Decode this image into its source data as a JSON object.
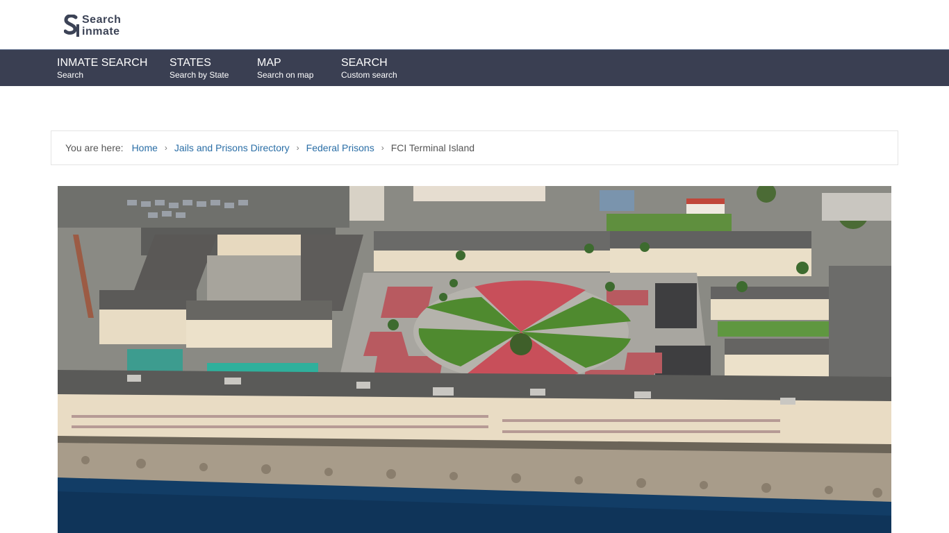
{
  "logo": {
    "line1": "Search",
    "line2": "inmate",
    "icon": "si-logo-icon"
  },
  "nav": [
    {
      "title": "INMATE SEARCH",
      "sub": "Search"
    },
    {
      "title": "STATES",
      "sub": "Search by State"
    },
    {
      "title": "MAP",
      "sub": "Search on map"
    },
    {
      "title": "SEARCH",
      "sub": "Custom search"
    }
  ],
  "breadcrumb": {
    "label": "You are here:",
    "items": [
      "Home",
      "Jails and Prisons Directory",
      "Federal Prisons"
    ],
    "current": "FCI Terminal Island",
    "separator": "›"
  },
  "colors": {
    "nav_bg": "#3a3f52",
    "link": "#2a6ea6",
    "logo": "#3c4356"
  }
}
